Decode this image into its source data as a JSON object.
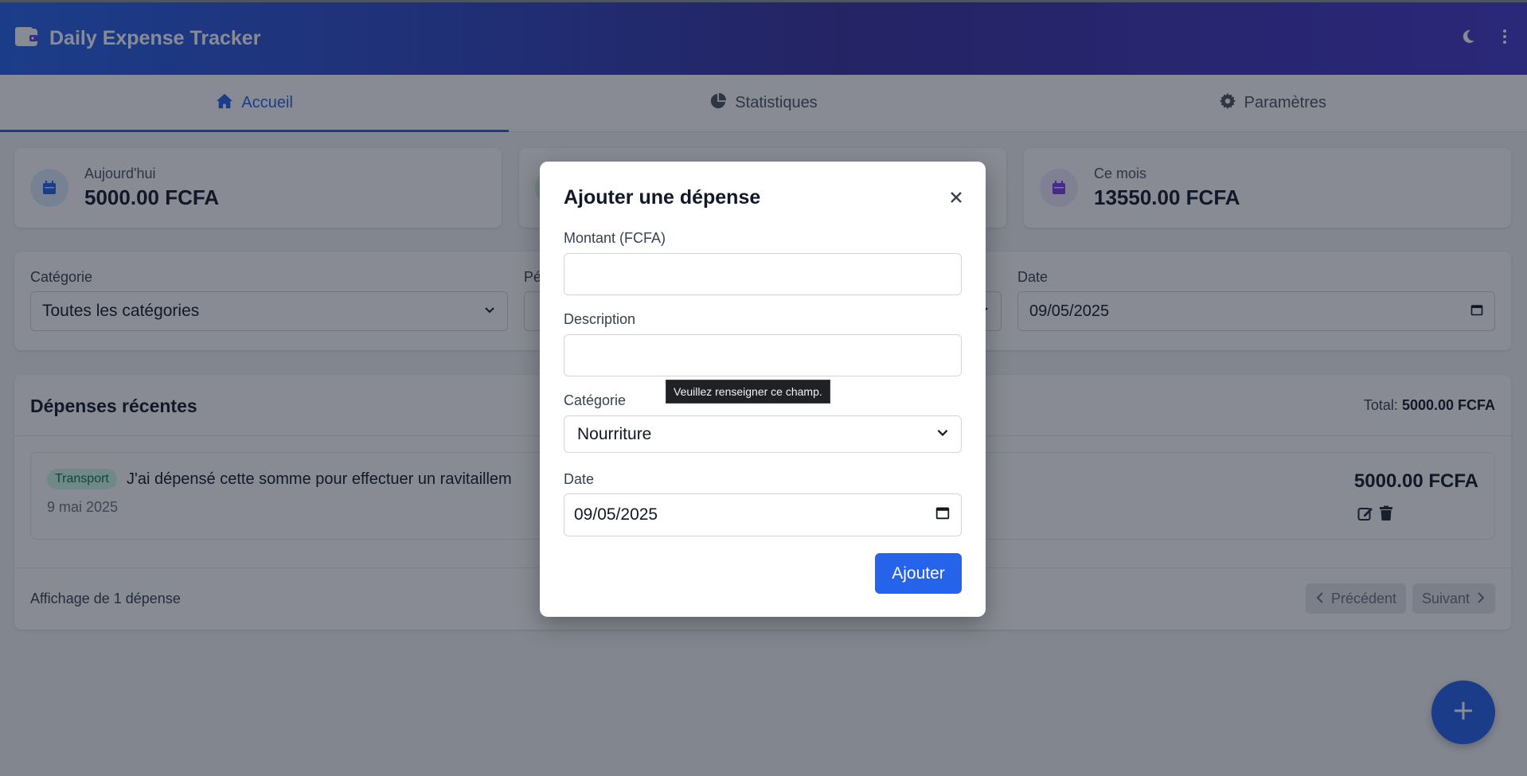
{
  "header": {
    "title": "Daily Expense Tracker",
    "wallet_icon": "wallet-icon",
    "theme_icon": "moon-icon",
    "menu_icon": "more-vertical-icon"
  },
  "tabs": [
    {
      "label": "Accueil",
      "icon": "home-icon",
      "active": true
    },
    {
      "label": "Statistiques",
      "icon": "pie-chart-icon",
      "active": false
    },
    {
      "label": "Paramètres",
      "icon": "gear-icon",
      "active": false
    }
  ],
  "summary": {
    "today": {
      "label": "Aujourd'hui",
      "value": "5000.00 FCFA"
    },
    "month": {
      "label": "Ce mois",
      "value": "13550.00 FCFA"
    }
  },
  "filters": {
    "category_label": "Catégorie",
    "category_value": "Toutes les catégories",
    "period_label": "Pé",
    "date_label": "Date",
    "date_value": "09/05/2025"
  },
  "recent": {
    "title": "Dépenses récentes",
    "total_label": "Total:",
    "total_value": "5000.00 FCFA",
    "items": [
      {
        "category": "Transport",
        "description": "J'ai dépensé cette somme pour effectuer un ravitaillem",
        "date": "9 mai 2025",
        "amount": "5000.00 FCFA"
      }
    ],
    "count_text": "Affichage de 1 dépense",
    "prev_label": "Précédent",
    "next_label": "Suivant"
  },
  "modal": {
    "title": "Ajouter une dépense",
    "amount_label": "Montant (FCFA)",
    "amount_value": "",
    "description_label": "Description",
    "description_value": "",
    "category_label": "Catégorie",
    "category_value": "Nourriture",
    "date_label": "Date",
    "date_value": "09/05/2025",
    "submit_label": "Ajouter",
    "validation_tooltip": "Veuillez renseigner ce champ."
  },
  "colors": {
    "primary": "#2563eb",
    "header_end": "#3730a3",
    "badge_bg": "#d1fae5",
    "badge_text": "#047857"
  }
}
